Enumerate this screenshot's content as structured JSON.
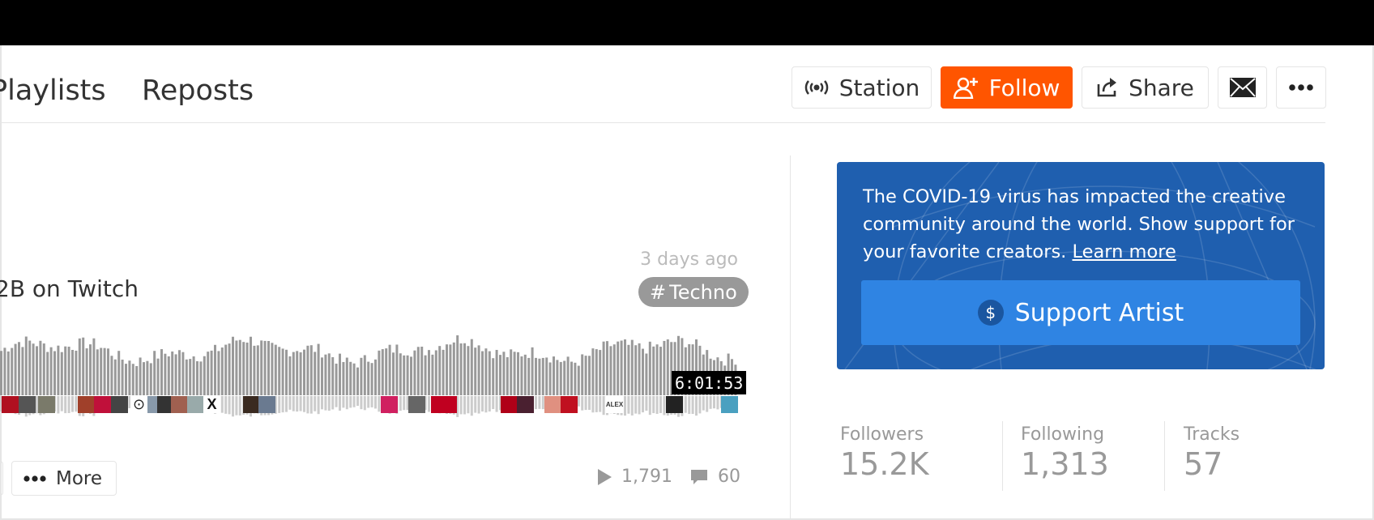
{
  "tabs": {
    "playlists": "Playlists",
    "reposts": "Reposts"
  },
  "header_buttons": {
    "station": "Station",
    "follow": "Follow",
    "share": "Share",
    "mail_icon": "envelope-icon",
    "more_icon": "ellipsis-icon"
  },
  "colors": {
    "follow_bg": "#ff5500",
    "support_card_bg": "#1f5faf",
    "support_button_bg": "#2f84e3"
  },
  "track": {
    "posted": "3 days ago",
    "title": "2B on Twitch",
    "tag_hash": "#",
    "tag": "Techno",
    "duration": "6:01:53",
    "plays": "1,791",
    "comments": "60",
    "more_label": "More",
    "comment_avatar_text": {
      "target": "⊙",
      "x": "X",
      "alex": "ALEX"
    }
  },
  "support": {
    "text": "The COVID-19 virus has impacted the creative community around the world. Show support for your favorite creators.",
    "link": "Learn more",
    "button": "Support Artist",
    "button_icon_text": "$"
  },
  "stats": [
    {
      "label": "Followers",
      "value": "15.2K"
    },
    {
      "label": "Following",
      "value": "1,313"
    },
    {
      "label": "Tracks",
      "value": "57"
    }
  ]
}
